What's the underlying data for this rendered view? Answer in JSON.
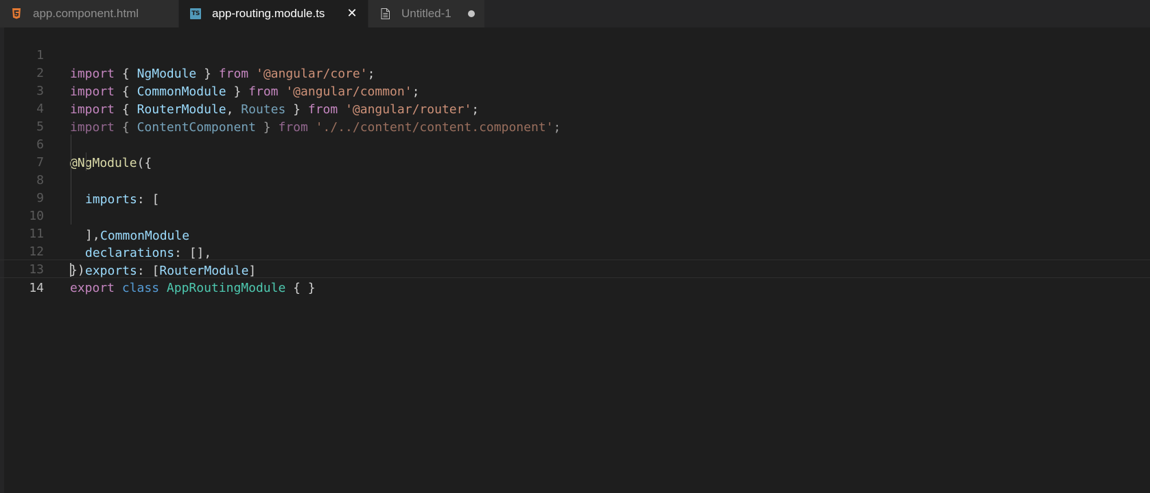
{
  "tabs": [
    {
      "label": "app.component.html",
      "icon": "html5-icon",
      "active": false
    },
    {
      "label": "app-routing.module.ts",
      "icon": "typescript-icon",
      "icon_text": "TS",
      "active": true,
      "close": "✕"
    },
    {
      "label": "Untitled-1",
      "icon": "file-icon",
      "active": false,
      "dirty": true
    }
  ],
  "editor": {
    "current_line": 14,
    "lines": [
      {
        "n": "1"
      },
      {
        "n": "2"
      },
      {
        "n": "3"
      },
      {
        "n": "4"
      },
      {
        "n": "5"
      },
      {
        "n": "6"
      },
      {
        "n": "7"
      },
      {
        "n": "8"
      },
      {
        "n": "9"
      },
      {
        "n": "10"
      },
      {
        "n": "11"
      },
      {
        "n": "12"
      },
      {
        "n": "13"
      },
      {
        "n": "14"
      }
    ],
    "tokens": {
      "import": "import",
      "from": "from",
      "export": "export",
      "class": "class",
      "lbrace": "{ ",
      "rbrace": " }",
      "comma": ", ",
      "semi": ";",
      "NgModule": "NgModule",
      "CommonModule": "CommonModule",
      "RouterModule": "RouterModule",
      "Routes": "Routes",
      "ContentComponent": "ContentComponent",
      "core": "'@angular/core'",
      "common": "'@angular/common'",
      "router": "'@angular/router'",
      "content": "'./../content/content.component'",
      "decorator": "@NgModule",
      "decorator_open": "({",
      "imports_key": "imports",
      "imports_open": ": [",
      "bracket_close": "],",
      "declarations_key": "declarations",
      "declarations_val": ": [],",
      "exports_key": "exports",
      "exports_open": ": [",
      "exports_close": "]",
      "decorator_close": "})",
      "AppRoutingModule": "AppRoutingModule",
      "empty_body": " { }"
    }
  },
  "colors": {
    "background": "#1e1e1e",
    "tabbar": "#252526",
    "keyword": "#c586c0",
    "string": "#ce9178",
    "variable": "#9cdcfe",
    "type": "#4ec9b0",
    "decorator": "#dcdcaa"
  }
}
